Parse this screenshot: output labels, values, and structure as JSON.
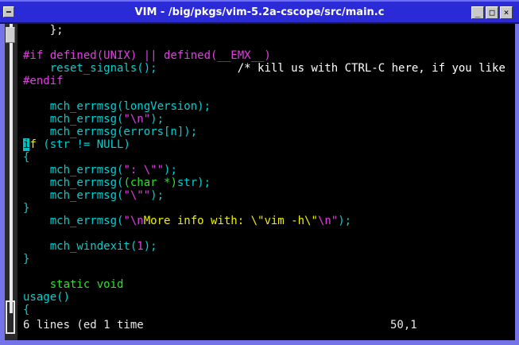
{
  "window": {
    "title": "VIM - /big/pkgs/vim-5.2a-cscope/src/main.c",
    "minimize_glyph": "_",
    "maximize_glyph": "□",
    "close_glyph": "×"
  },
  "code": {
    "l1": "    };",
    "l3": "#if defined(UNIX) || defined(__EMX__)",
    "l4a": "    reset_signals();",
    "l4b": "            /* kill us with CTRL-C here, if you like */",
    "l5": "#endif",
    "l7": "    mch_errmsg(longVersion);",
    "l8a": "    mch_errmsg(",
    "l8b": "\"\\n\"",
    "l8c": ");",
    "l9": "    mch_errmsg(errors[n]);",
    "l10cursor": "i",
    "l10kw": "f",
    "l10rest": " (str != NULL)",
    "l11": "{",
    "l12a": "    mch_errmsg(",
    "l12b": "\": \\\"\"",
    "l12c": ");",
    "l13a": "    mch_errmsg(",
    "l13b": "(char *)",
    "l13c": "str);",
    "l14a": "    mch_errmsg(",
    "l14b": "\"\\\"\"",
    "l14c": ");",
    "l15": "}",
    "l16a": "    mch_errmsg(",
    "l16b": "\"\\n",
    "l16c": "More info with: \\\"vim -h\\\"",
    "l16d": "\\n\"",
    "l16e": ");",
    "l18a": "    mch_windexit(",
    "l18b": "1",
    "l18c": ");",
    "l19": "}",
    "l21": "    static void",
    "l22": "usage()",
    "l23": "{"
  },
  "status": {
    "message": "6 lines (ed 1 time",
    "ruler": "50,1"
  },
  "colors": {
    "titlebar": "#2a2ad6",
    "preproc": "#e040e0",
    "function": "#00d0d0",
    "string": "#e040e0",
    "keyword": "#f0f000",
    "type": "#30e030"
  }
}
